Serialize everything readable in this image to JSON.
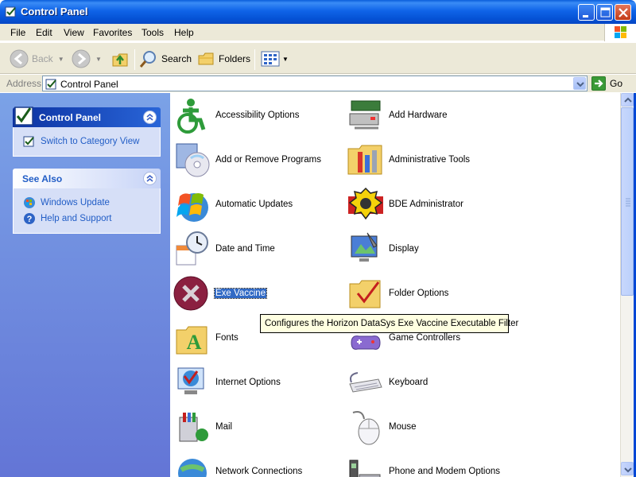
{
  "window": {
    "title": "Control Panel"
  },
  "menu": [
    "File",
    "Edit",
    "View",
    "Favorites",
    "Tools",
    "Help"
  ],
  "toolbar": {
    "back": "Back",
    "search": "Search",
    "folders": "Folders"
  },
  "address": {
    "label": "Address",
    "value": "Control Panel",
    "go": "Go"
  },
  "left_pane": {
    "control_panel": {
      "title": "Control Panel",
      "task": "Switch to Category View"
    },
    "see_also": {
      "title": "See Also",
      "items": [
        "Windows Update",
        "Help and Support"
      ]
    }
  },
  "items": [
    "Accessibility Options",
    "Add Hardware",
    "Add or Remove Programs",
    "Administrative Tools",
    "Automatic Updates",
    "BDE Administrator",
    "Date and Time",
    "Display",
    "Exe Vaccine",
    "Folder Options",
    "Fonts",
    "Game Controllers",
    "Internet Options",
    "Keyboard",
    "Mail",
    "Mouse",
    "Network Connections",
    "Phone and Modem Options"
  ],
  "selected_item": "Exe Vaccine",
  "tooltip": "Configures the Horizon DataSys Exe Vaccine Executable Filter",
  "colors": {
    "titlebar": "#0a5ddb",
    "left_pane": "#7ba2e7",
    "link": "#215dc6",
    "selection": "#316ac5",
    "tooltip_bg": "#ffffe1"
  }
}
